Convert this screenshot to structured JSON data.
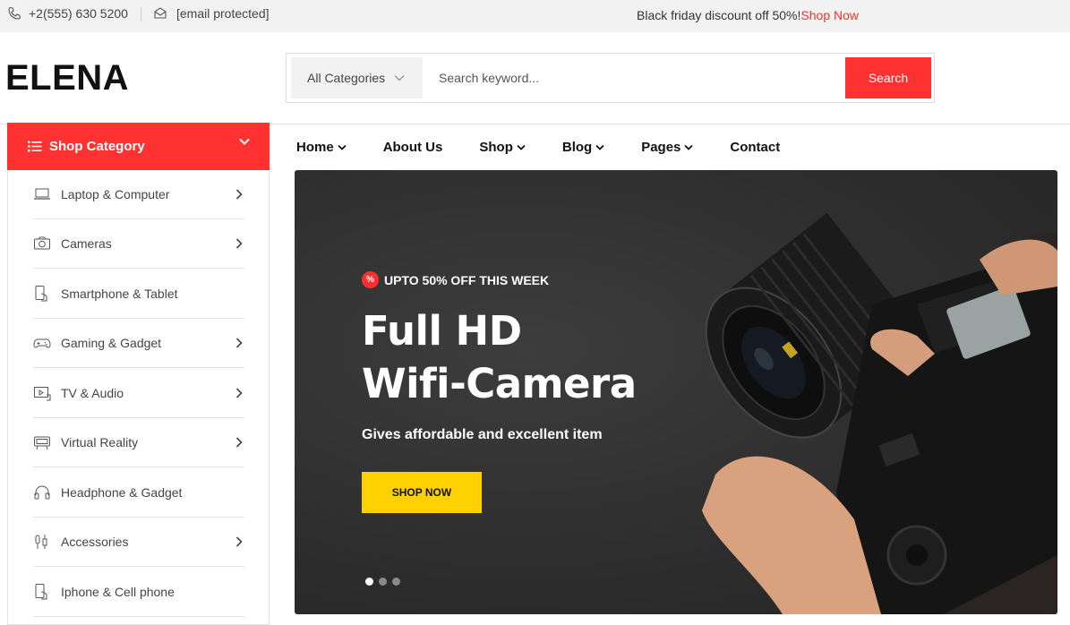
{
  "topbar": {
    "phone": "+2(555) 630 5200",
    "email": "[email protected]",
    "promo_text": "Black friday discount off 50%!",
    "promo_link": "Shop Now"
  },
  "header": {
    "logo": "ELENA",
    "category_select": "All Categories",
    "search_placeholder": "Search keyword...",
    "search_button": "Search"
  },
  "sidebar": {
    "title": "Shop Category",
    "items": [
      {
        "label": "Laptop & Computer",
        "icon": "laptop-icon",
        "has_arrow": true
      },
      {
        "label": "Cameras",
        "icon": "camera-icon",
        "has_arrow": true
      },
      {
        "label": "Smartphone & Tablet",
        "icon": "smartphone-icon",
        "has_arrow": false
      },
      {
        "label": "Gaming & Gadget",
        "icon": "gamepad-icon",
        "has_arrow": true
      },
      {
        "label": "TV & Audio",
        "icon": "tv-icon",
        "has_arrow": true
      },
      {
        "label": "Virtual Reality",
        "icon": "vr-headset-icon",
        "has_arrow": true
      },
      {
        "label": "Headphone & Gadget",
        "icon": "headphone-icon",
        "has_arrow": false
      },
      {
        "label": "Accessories",
        "icon": "accessories-icon",
        "has_arrow": true
      },
      {
        "label": "Iphone & Cell phone",
        "icon": "phone-hand-icon",
        "has_arrow": false
      }
    ]
  },
  "nav": {
    "items": [
      {
        "label": "Home",
        "dropdown": true
      },
      {
        "label": "About Us",
        "dropdown": false
      },
      {
        "label": "Shop",
        "dropdown": true
      },
      {
        "label": "Blog",
        "dropdown": true
      },
      {
        "label": "Pages",
        "dropdown": true
      },
      {
        "label": "Contact",
        "dropdown": false
      }
    ]
  },
  "hero": {
    "badge_symbol": "%",
    "badge": "UPTO 50% OFF THIS WEEK",
    "title_line1": "Full HD",
    "title_line2": "Wifi-Camera",
    "subtitle": "Gives affordable and excellent item",
    "button": "SHOP NOW",
    "slide_count": 3,
    "active_slide": 1
  },
  "colors": {
    "accent": "#ff3131",
    "button_yellow": "#ffd100",
    "hero_bg": "#2e2e2e"
  }
}
